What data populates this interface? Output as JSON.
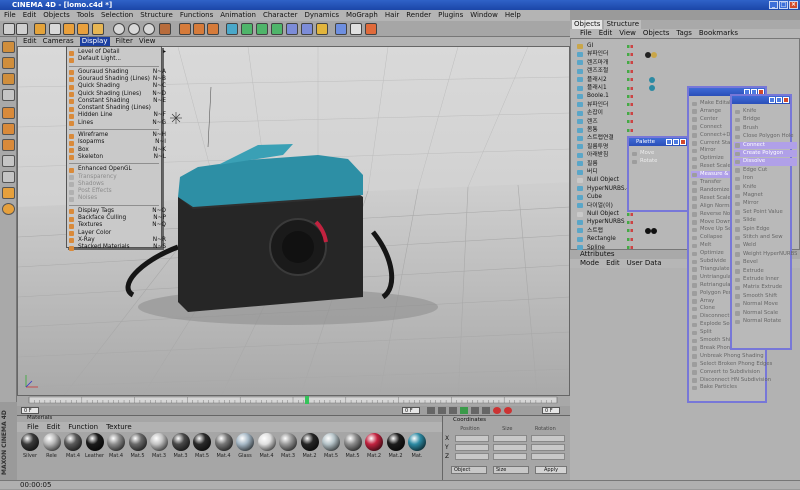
{
  "window": {
    "title": "CINEMA 4D - [lomo.c4d *]",
    "controls": [
      "_",
      "□",
      "×"
    ]
  },
  "menubar": [
    "File",
    "Edit",
    "Objects",
    "Tools",
    "Selection",
    "Structure",
    "Functions",
    "Animation",
    "Character",
    "Dynamics",
    "MoGraph",
    "Hair",
    "Render",
    "Plugins",
    "Window",
    "Help"
  ],
  "viewport": {
    "menu": [
      "Edit",
      "Cameras",
      "Display",
      "Filter",
      "View"
    ],
    "active_menu": "Display",
    "display_menu": [
      {
        "label": "Level of Detail",
        "shortcut": "▸",
        "state": "normal"
      },
      {
        "label": "Default Light...",
        "shortcut": "",
        "state": "normal"
      },
      {
        "sep": true
      },
      {
        "label": "Gouraud Shading",
        "shortcut": "N~A",
        "state": "normal"
      },
      {
        "label": "Gouraud Shading (Lines)",
        "shortcut": "N~B",
        "state": "normal"
      },
      {
        "label": "Quick Shading",
        "shortcut": "N~C",
        "state": "normal"
      },
      {
        "label": "Quick Shading (Lines)",
        "shortcut": "N~D",
        "state": "normal"
      },
      {
        "label": "Constant Shading",
        "shortcut": "N~E",
        "state": "normal"
      },
      {
        "label": "Constant Shading (Lines)",
        "shortcut": "",
        "state": "normal"
      },
      {
        "label": "Hidden Line",
        "shortcut": "N~F",
        "state": "normal"
      },
      {
        "label": "Lines",
        "shortcut": "N~G",
        "state": "normal"
      },
      {
        "sep": true
      },
      {
        "label": "Wireframe",
        "shortcut": "N~H",
        "state": "normal"
      },
      {
        "label": "Isoparms",
        "shortcut": "N~I",
        "state": "normal"
      },
      {
        "label": "Box",
        "shortcut": "N~K",
        "state": "normal"
      },
      {
        "label": "Skeleton",
        "shortcut": "N~L",
        "state": "normal"
      },
      {
        "sep": true
      },
      {
        "label": "Enhanced OpenGL",
        "shortcut": "",
        "state": "normal"
      },
      {
        "label": "Transparency",
        "shortcut": "",
        "state": "dim"
      },
      {
        "label": "Shadows",
        "shortcut": "",
        "state": "dim"
      },
      {
        "label": "Post Effects",
        "shortcut": "",
        "state": "dim"
      },
      {
        "label": "Noises",
        "shortcut": "",
        "state": "dim"
      },
      {
        "sep": true
      },
      {
        "label": "Display Tags",
        "shortcut": "N~O",
        "state": "normal"
      },
      {
        "label": "Backface Culling",
        "shortcut": "N~P",
        "state": "normal"
      },
      {
        "label": "Textures",
        "shortcut": "N~Q",
        "state": "normal"
      },
      {
        "label": "Layer Color",
        "shortcut": "",
        "state": "normal"
      },
      {
        "label": "X-Ray",
        "shortcut": "N~R",
        "state": "normal"
      },
      {
        "label": "Stacked Materials",
        "shortcut": "N~S",
        "state": "normal"
      }
    ]
  },
  "timeline": {
    "start": "0 F",
    "current": "0 F",
    "end": "0 F"
  },
  "materials": {
    "title": "Materials",
    "menu": [
      "File",
      "Edit",
      "Function",
      "Texture"
    ],
    "items": [
      {
        "label": "Silver",
        "color": "#3a3a3a"
      },
      {
        "label": "Rele",
        "color": "#b8b8b8"
      },
      {
        "label": "Mat.4",
        "color": "#5a5a5a"
      },
      {
        "label": "Leather",
        "color": "#1a1a1a"
      },
      {
        "label": "Mat.4",
        "color": "#8d8d8d"
      },
      {
        "label": "Mat.5",
        "color": "#6a6a6a"
      },
      {
        "label": "Mat.3",
        "color": "#c4c4c4"
      },
      {
        "label": "Mat.3",
        "color": "#4a4a4a"
      },
      {
        "label": "Mat.5",
        "color": "#2a2a2a"
      },
      {
        "label": "Mat.4",
        "color": "#777777"
      },
      {
        "label": "Glass",
        "color": "#a6b8c6"
      },
      {
        "label": "Mat.4",
        "color": "#e0e0e0"
      },
      {
        "label": "Mat.3",
        "color": "#9a9a9a"
      },
      {
        "label": "Mat.2",
        "color": "#252525"
      },
      {
        "label": "Mat.5",
        "color": "#b5c3c8"
      },
      {
        "label": "Mat.5",
        "color": "#8c8c8c"
      },
      {
        "label": "Mat.2",
        "color": "#c2223f"
      },
      {
        "label": "Mat.2",
        "color": "#1b1b1b"
      },
      {
        "label": "Mat.",
        "color": "#2c8aa3"
      }
    ]
  },
  "coordinates": {
    "title": "Coordinates",
    "rows": [
      "X",
      "Y",
      "Z"
    ],
    "headers": [
      "Position",
      "Size",
      "Rotation"
    ],
    "mode": "Object",
    "size_mode": "Size",
    "apply": "Apply"
  },
  "status": {
    "time": "00:00:05"
  },
  "side_logo": "MAXON CINEMA 4D",
  "object_manager": {
    "tabs": [
      "Objects",
      "Structure"
    ],
    "menu": [
      "File",
      "Edit",
      "View",
      "Objects",
      "Tags",
      "Bookmarks"
    ],
    "rows": [
      {
        "label": "GI",
        "color": "#c9a64a"
      },
      {
        "label": "뷰파인더",
        "color": "#5aa6c8"
      },
      {
        "label": "렌즈마개",
        "color": "#5aa6c8"
      },
      {
        "label": "렌즈조절",
        "color": "#5aa6c8"
      },
      {
        "label": "플래시2",
        "color": "#5aa6c8"
      },
      {
        "label": "플래시1",
        "color": "#5aa6c8"
      },
      {
        "label": "Boole.1",
        "color": "#5aa6c8"
      },
      {
        "label": "뷰파인더",
        "color": "#5aa6c8"
      },
      {
        "label": "손잡이",
        "color": "#5aa6c8"
      },
      {
        "label": "렌즈",
        "color": "#5aa6c8"
      },
      {
        "label": "몸통",
        "color": "#5aa6c8"
      },
      {
        "label": "스트랩연결",
        "color": "#5aa6c8"
      },
      {
        "label": "필름투명",
        "color": "#5aa6c8"
      },
      {
        "label": "아래받침",
        "color": "#5aa6c8"
      },
      {
        "label": "필름",
        "color": "#5aa6c8"
      },
      {
        "label": "버디",
        "color": "#5aa6c8"
      },
      {
        "label": "Null Object",
        "color": "#c9c9c9"
      },
      {
        "label": "HyperNURBS.4",
        "color": "#5aa6c8"
      },
      {
        "label": "Cube",
        "color": "#5aa6c8"
      },
      {
        "label": "다이얼(이)",
        "color": "#5aa6c8"
      },
      {
        "label": "Null Object",
        "color": "#c9c9c9"
      },
      {
        "label": "HyperNURBS",
        "color": "#5aa6c8"
      },
      {
        "label": "스트랩",
        "color": "#5aa6c8"
      },
      {
        "label": "Rectangle",
        "color": "#5aa6c8"
      },
      {
        "label": "Spline",
        "color": "#5aa6c8"
      }
    ]
  },
  "attributes": {
    "title": "Attributes",
    "menu": [
      "Mode",
      "Edit",
      "User Data"
    ]
  },
  "palettes": {
    "small": {
      "title": "Palette",
      "items": [
        "Move",
        "Rotate"
      ]
    },
    "large1": {
      "title": "",
      "items": [
        "Make Editable",
        "Arrange",
        "Center",
        "Connect",
        "Connect+Delete",
        "Current State to Object",
        "Mirror",
        "Optimize",
        "Reset Scale",
        "Measure & Construction",
        "Transfer",
        "Randomize",
        "Reset Scale",
        "Align Normals",
        "Reverse Normals",
        "Move Down Sequence",
        "Move Up Sequence",
        "Collapse",
        "Melt",
        "Optimize",
        "Subdivide",
        "Triangulate",
        "Untriangulate",
        "Retriangulate",
        "Polygon Pen",
        "Array",
        "Clone",
        "Disconnect",
        "Explode Segments",
        "Split",
        "Smooth Shift",
        "Break Phong Shading",
        "Unbreak Phong Shading",
        "Select Broken Phong Edges",
        "Convert to Subdivision",
        "Disconnect HN Subdivision",
        "Bake Particles"
      ]
    },
    "large2": {
      "title": "",
      "items": [
        "Knife",
        "Bridge",
        "Brush",
        "Close Polygon Hole",
        "Connect",
        "Create Polygon",
        "Dissolve",
        "Edge Cut",
        "Iron",
        "Knife",
        "Magnet",
        "Mirror",
        "Set Point Value",
        "Slide",
        "Spin Edge",
        "Stitch and Sew",
        "Weld",
        "Weight HyperNURBS",
        "Bevel",
        "Extrude",
        "Extrude Inner",
        "Matrix Extrude",
        "Smooth Shift",
        "Normal Move",
        "Normal Scale",
        "Normal Rotate"
      ]
    }
  }
}
